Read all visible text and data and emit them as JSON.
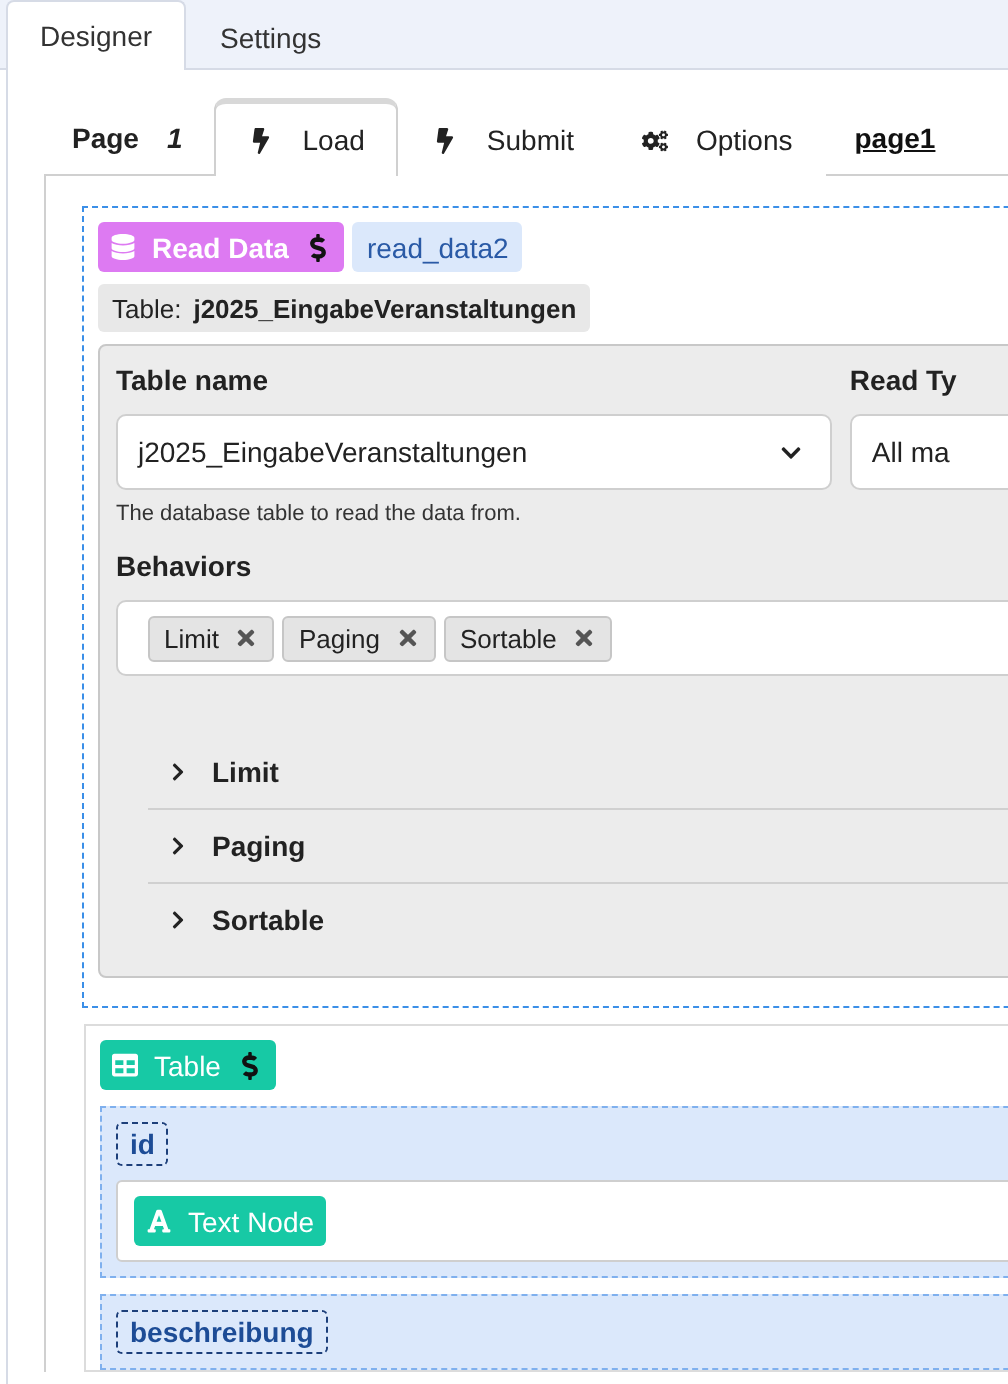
{
  "top_tabs": [
    {
      "label": "Designer",
      "selected": true
    },
    {
      "label": "Settings",
      "selected": false
    }
  ],
  "page_bar": {
    "label": "Page",
    "number": "1",
    "tabs": [
      {
        "label": "Load",
        "kind": "event",
        "selected": true
      },
      {
        "label": "Submit",
        "kind": "event",
        "selected": false
      },
      {
        "label": "Options",
        "kind": "options",
        "selected": false
      }
    ],
    "page_name": "page1"
  },
  "read_data": {
    "badge": "Read Data",
    "name": "read_data2",
    "table_label": "Table:",
    "table_value": "j2025_EingabeVeranstaltungen",
    "table_name": {
      "label": "Table name",
      "value": "j2025_EingabeVeranstaltungen",
      "help": "The database table to read the data from."
    },
    "read_type": {
      "label": "Read Ty",
      "value": "All ma"
    },
    "behaviors": {
      "label": "Behaviors",
      "tags": [
        "Limit",
        "Paging",
        "Sortable"
      ]
    },
    "sections": [
      {
        "label": "Limit",
        "expanded": false
      },
      {
        "label": "Paging",
        "expanded": false
      },
      {
        "label": "Sortable",
        "expanded": false
      }
    ]
  },
  "table": {
    "badge": "Table",
    "columns": [
      {
        "name": "id",
        "nodes": [
          "Text Node"
        ]
      },
      {
        "name": "beschreibung"
      }
    ]
  }
}
